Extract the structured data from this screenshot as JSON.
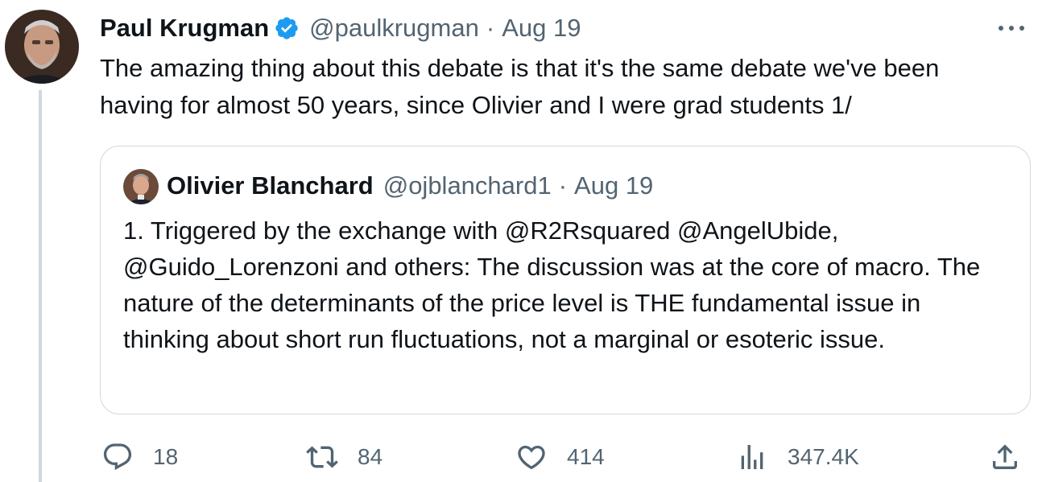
{
  "tweet": {
    "author_name": "Paul Krugman",
    "handle": "@paulkrugman",
    "separator": "·",
    "date": "Aug 19",
    "verified": true,
    "text": "The amazing thing about this debate is that it's the same debate we've been having for almost 50 years, since Olivier and I were grad students 1/",
    "avatar_icon": "person-avatar",
    "more_icon": "more-horizontal-icon"
  },
  "quote": {
    "author_name": "Olivier Blanchard",
    "handle": "@ojblanchard1",
    "separator": "·",
    "date": "Aug 19",
    "text": "1. Triggered by the exchange with @R2Rsquared @AngelUbide, @Guido_Lorenzoni and others:  The discussion was at the core of macro. The nature of the determinants of the price level is THE fundamental issue in thinking about short run fluctuations, not a marginal or esoteric issue."
  },
  "actions": {
    "replies": "18",
    "retweets": "84",
    "likes": "414",
    "views": "347.4K",
    "icons": [
      "reply-icon",
      "retweet-icon",
      "like-icon",
      "views-icon",
      "share-icon"
    ]
  },
  "colors": {
    "text": "#0f1419",
    "secondary": "#536471",
    "verified": "#1d9bf0",
    "border": "#cfd9de"
  }
}
